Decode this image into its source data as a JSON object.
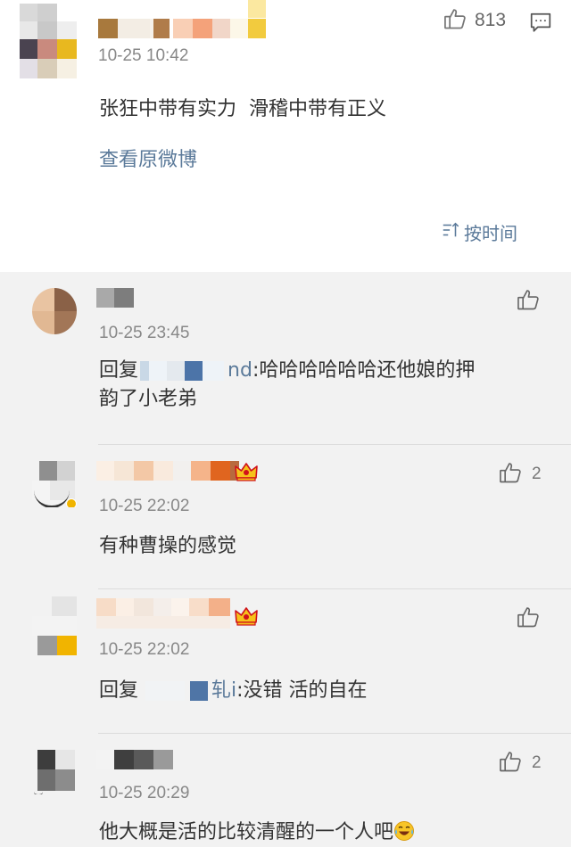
{
  "post": {
    "time": "10-25 10:42",
    "content": "张狂中带有实力  滑稽中带有正义",
    "view_original_label": "查看原微博",
    "like_count": "813",
    "sort_label": "按时间",
    "icons": {
      "like": "thumbs-up-icon",
      "comment": "comment-icon",
      "sort": "sort-icon"
    }
  },
  "comments": [
    {
      "time": "10-25 23:45",
      "reply_prefix": "回复",
      "mention_tail": "nd",
      "text": ":哈哈哈哈哈哈还他娘的押",
      "text_line2": "韵了小老弟",
      "like_count": ""
    },
    {
      "time": "10-25 22:02",
      "text": "有种曹操的感觉",
      "like_count": "2",
      "badge": "crown-icon"
    },
    {
      "time": "10-25 22:02",
      "reply_prefix": "回复",
      "mention_tail": "轧i",
      "text": ":没错 活的自在",
      "like_count": "",
      "badge": "crown-icon"
    },
    {
      "time": "10-25 20:29",
      "text": "他大概是活的比较清醒的一个人吧",
      "like_count": "2",
      "emoji": "laughing-tears-emoji"
    }
  ],
  "colors": {
    "link": "#5b7a9a",
    "background": "#f2f2f2",
    "card": "#ffffff"
  }
}
